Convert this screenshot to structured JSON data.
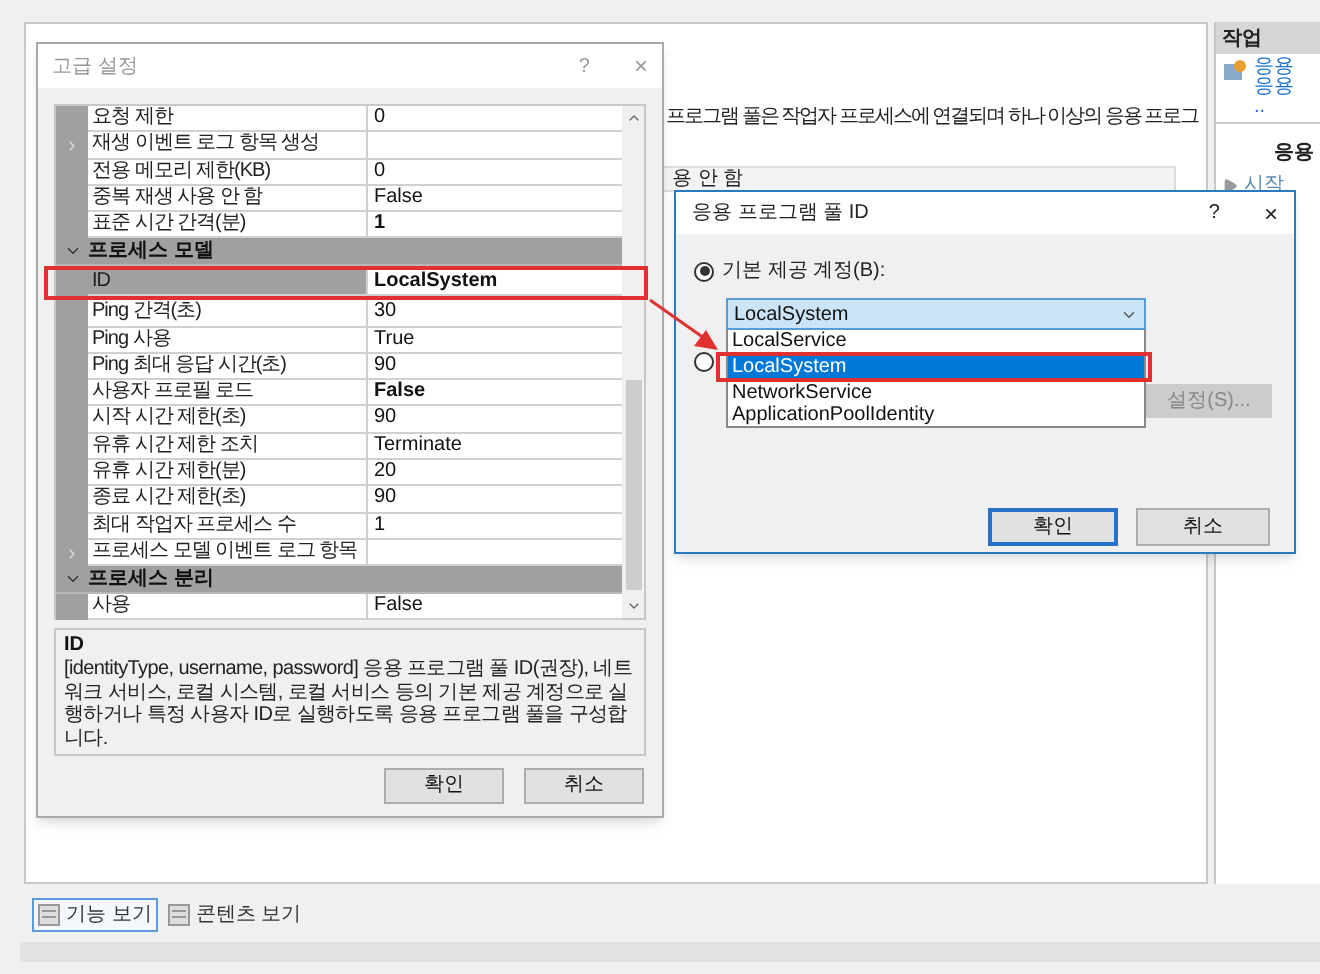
{
  "background": {
    "description": "프로그램 풀은 작업자 프로세스에 연결되며 하나 이상의 응용 프로그",
    "dropdown_value": "용 안 함"
  },
  "actions_panel": {
    "title": "작업",
    "links": [
      "응용",
      "응용",
      ".."
    ],
    "section": "응용",
    "start": "시작"
  },
  "view_tabs": [
    {
      "label": "기능 보기",
      "selected": true
    },
    {
      "label": "콘텐츠 보기",
      "selected": false
    }
  ],
  "advanced_settings": {
    "title": "고급 설정",
    "help": "?",
    "close": "×",
    "rows": [
      {
        "kind": "property",
        "name": "요청 제한",
        "value": "0",
        "modified": false,
        "selected": false
      },
      {
        "kind": "group",
        "name": "재생 이벤트 로그 항목 생성",
        "value": "",
        "modified": false,
        "selected": false
      },
      {
        "kind": "property",
        "name": "전용 메모리 제한(KB)",
        "value": "0",
        "modified": false,
        "selected": false
      },
      {
        "kind": "property",
        "name": "중복 재생 사용 안 함",
        "value": "False",
        "modified": false,
        "selected": false
      },
      {
        "kind": "property",
        "name": "표준 시간 간격(분)",
        "value": "1",
        "modified": true,
        "selected": false
      },
      {
        "kind": "category",
        "name": "프로세스 모델",
        "expanded": true
      },
      {
        "kind": "property",
        "name": "ID",
        "value": "LocalSystem",
        "modified": true,
        "selected": true
      },
      {
        "kind": "property",
        "name": "Ping 간격(초)",
        "value": "30",
        "modified": false,
        "selected": false
      },
      {
        "kind": "property",
        "name": "Ping 사용",
        "value": "True",
        "modified": false,
        "selected": false
      },
      {
        "kind": "property",
        "name": "Ping 최대 응답 시간(초)",
        "value": "90",
        "modified": false,
        "selected": false
      },
      {
        "kind": "property",
        "name": "사용자 프로필 로드",
        "value": "False",
        "modified": true,
        "selected": false
      },
      {
        "kind": "property",
        "name": "시작 시간 제한(초)",
        "value": "90",
        "modified": false,
        "selected": false
      },
      {
        "kind": "property",
        "name": "유휴 시간 제한 조치",
        "value": "Terminate",
        "modified": false,
        "selected": false
      },
      {
        "kind": "property",
        "name": "유휴 시간 제한(분)",
        "value": "20",
        "modified": false,
        "selected": false
      },
      {
        "kind": "property",
        "name": "종료 시간 제한(초)",
        "value": "90",
        "modified": false,
        "selected": false
      },
      {
        "kind": "property",
        "name": "최대 작업자 프로세스 수",
        "value": "1",
        "modified": false,
        "selected": false
      },
      {
        "kind": "group",
        "name": "프로세스 모델 이벤트 로그 항목",
        "value": "",
        "modified": false,
        "selected": false
      },
      {
        "kind": "category",
        "name": "프로세스 분리",
        "expanded": true
      },
      {
        "kind": "property",
        "name": "사용",
        "value": "False",
        "modified": false,
        "selected": false
      }
    ],
    "description_title": "ID",
    "description": "[identityType, username, password] 응용 프로그램 풀 ID(권장), 네트워크 서비스, 로컬 시스템, 로컬 서비스 등의 기본 제공 계정으로 실행하거나 특정 사용자 ID로 실행하도록 응용 프로그램 풀을 구성합니다.",
    "buttons": [
      "확인",
      "취소"
    ]
  },
  "identity_dialog": {
    "title": "응용 프로그램 풀 ID",
    "help": "?",
    "close": "×",
    "builtin_radio": {
      "label": "기본 제공 계정(B):",
      "selected": true
    },
    "custom_radio": {
      "selected": false
    },
    "account_select": {
      "value": "LocalSystem"
    },
    "options": [
      {
        "label": "LocalService",
        "selected": false
      },
      {
        "label": "LocalSystem",
        "selected": true
      },
      {
        "label": "NetworkService",
        "selected": false
      },
      {
        "label": "ApplicationPoolIdentity",
        "selected": false
      }
    ],
    "set_button": {
      "label": "설정(S)...",
      "disabled": true
    },
    "buttons": [
      "확인",
      "취소"
    ]
  }
}
